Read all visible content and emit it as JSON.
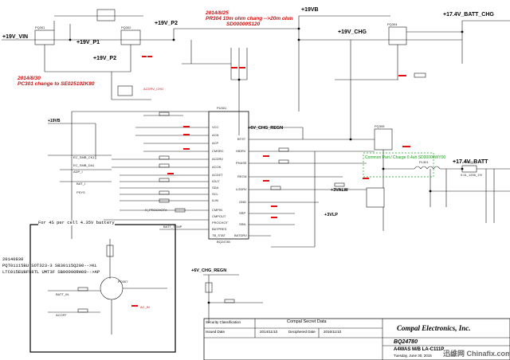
{
  "rails": {
    "v19_vin": "+19V_VIN",
    "v19_p1": "+19V_P1",
    "v19_p2": "+19V_P2",
    "v19_p2b": "+19V_P2",
    "v19_vb": "+19VB",
    "v19_chg": "+19V_CHG",
    "v17_batt_chg": "+17.4V_BATT_CHG",
    "v17_batt": "+17.4V_BATT",
    "chg_regn": "+6V_CHG_REGN",
    "chg_regn_b": "+6V_CHG_REGN",
    "v19vb_small": "+19VB",
    "v3valw": "+3VALW",
    "v3vlp": "+3VLP"
  },
  "notes": {
    "note1_line1": "2014/8/25",
    "note1_line2": "PR304  10m ohm chang -->20m ohm",
    "note1_line3": "SD00000S120",
    "note2_line1": "2014/8/30",
    "note2_line2": "PC301  change to SE025102K80",
    "box_title": "For 4S per cell 4.35V battery",
    "box_line1": "20140930",
    "box_line2": "PQT01115BU SOT323-3 SB30115Q200-->KL",
    "box_line3": "LTC015EUBFS8TL UMT3F SB00000RH00-->AP"
  },
  "parts": {
    "u1": "PU301",
    "u1_part": "BQ24780",
    "q_top_left": "PQ301",
    "q_top_mid": "PQ302",
    "q_right_top": "PQ304",
    "q_right_mid": "PQ305",
    "q_box": "PQ307",
    "inductor": "PL301",
    "sense_r": "PR304",
    "sense_r_val": "0.01_1206_1%"
  },
  "pins": [
    "ACN",
    "ACP",
    "CMSRC",
    "ACDRV",
    "ACOK",
    "ACDET",
    "IOUT",
    "SDA",
    "SCL",
    "ILIM",
    "CMPIN",
    "CMPOUT",
    "PROCHOT",
    "IADP",
    "IDCHG",
    "PMON",
    "BATPRES",
    "TB_STAT",
    "BATDRV",
    "BATSRC",
    "VCC",
    "PHASE",
    "HIDRV",
    "BTST",
    "REGN",
    "LODRV",
    "GND",
    "SRP",
    "SRN"
  ],
  "signals": {
    "ac_in": "AC_IN",
    "ec_smb_ck1": "EC_SMB_CK1",
    "ec_smb_da1": "EC_SMB_DA1",
    "adp_i": "ADP_I",
    "bat_i": "BAT_I",
    "psys": "PSYS",
    "prochot": "H_PROCHOT#",
    "batt_temp": "BATT_TEMP",
    "acdrv_chg": "ACDRV_CHG",
    "bat_in": "BATT_IN",
    "acoff": "ACOFF"
  },
  "green_label": "Common Part / Charge 0.4uh SD00000WY00",
  "title_block": {
    "sec_class_label": "Security Classification",
    "sec_class_value": "Compal Secret Data",
    "issued_label": "Issued Date",
    "issued_value": "2014/11/10",
    "deciphered_label": "Deciphered Date",
    "deciphered_value": "2016/11/10",
    "company": "Compal Electronics, Inc.",
    "part": "BQ24780",
    "board": "A4WAS M/B LA-C111P",
    "date": "Tuesday, June 30, 2015",
    "sheet": "39"
  },
  "watermark": "迅维网 Chinafix.com"
}
